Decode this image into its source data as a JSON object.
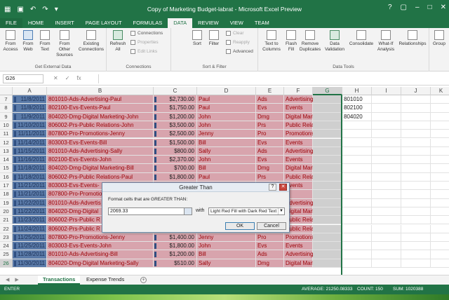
{
  "window": {
    "title": "Copy of Marketing Budget-labrat - Microsoft Excel Preview",
    "controls": [
      "?",
      "▢",
      "–",
      "□",
      "✕"
    ]
  },
  "ribbon_tabs": [
    "FILE",
    "HOME",
    "INSERT",
    "PAGE LAYOUT",
    "FORMULAS",
    "DATA",
    "REVIEW",
    "VIEW",
    "TEAM"
  ],
  "ribbon": {
    "get_external": {
      "label": "Get External Data",
      "buttons": [
        "From Access",
        "From Web",
        "From Text",
        "From Other Sources",
        "Existing Connections"
      ]
    },
    "connections": {
      "label": "Connections",
      "refresh": "Refresh All",
      "items": [
        "Connections",
        "Properties",
        "Edit Links"
      ]
    },
    "sort_filter": {
      "label": "Sort & Filter",
      "sort": "Sort",
      "filter": "Filter",
      "items": [
        "Clear",
        "Reapply",
        "Advanced"
      ]
    },
    "data_tools": {
      "label": "Data Tools",
      "buttons": [
        "Text to Columns",
        "Flash Fill",
        "Remove Duplicates",
        "Data Validation",
        "Consolidate",
        "What-If Analysis",
        "Relationships"
      ]
    },
    "outline": {
      "label": "Group"
    }
  },
  "formula_bar": {
    "name_box": "G26",
    "icons": [
      "✕",
      "✓",
      "fx"
    ],
    "value": ""
  },
  "columns": [
    "A",
    "B",
    "C",
    "D",
    "E",
    "F",
    "G",
    "H",
    "I",
    "J",
    "K"
  ],
  "rows": [
    {
      "n": "7",
      "a": "11/8/2011",
      "b": "801010-Ads-Advertising-Paul",
      "c": "$2,730.00",
      "d": "Paul",
      "e": "Ads",
      "f": "Advertising",
      "h": "801010"
    },
    {
      "n": "8",
      "a": "11/8/2011",
      "b": "802100-Evs-Events-Paul",
      "c": "$1,750.00",
      "d": "Paul",
      "e": "Evs",
      "f": "Events",
      "h": "802100"
    },
    {
      "n": "9",
      "a": "11/9/2011",
      "b": "804020-Dmg-Digital Marketing-John",
      "c": "$1,200.00",
      "d": "John",
      "e": "Dmg",
      "f": "Digital Marketing",
      "h": "804020"
    },
    {
      "n": "10",
      "a": "11/10/2011",
      "b": "806002-Prs-Public Relations-John",
      "c": "$3,500.00",
      "d": "John",
      "e": "Prs",
      "f": "Public Relations",
      "h": ""
    },
    {
      "n": "11",
      "a": "11/11/2011",
      "b": "807800-Pro-Promotions-Jenny",
      "c": "$2,500.00",
      "d": "Jenny",
      "e": "Pro",
      "f": "Promotions",
      "h": ""
    },
    {
      "n": "12",
      "a": "11/14/2011",
      "b": "803003-Evs-Events-Bill",
      "c": "$1,500.00",
      "d": "Bill",
      "e": "Evs",
      "f": "Events",
      "h": ""
    },
    {
      "n": "13",
      "a": "11/15/2011",
      "b": "801010-Ads-Advertising-Sally",
      "c": "$800.00",
      "d": "Sally",
      "e": "Ads",
      "f": "Advertising",
      "h": ""
    },
    {
      "n": "14",
      "a": "11/16/2011",
      "b": "802100-Evs-Events-John",
      "c": "$2,370.00",
      "d": "John",
      "e": "Evs",
      "f": "Events",
      "h": ""
    },
    {
      "n": "15",
      "a": "11/18/2011",
      "b": "804020-Dmg-Digital Marketing-Bill",
      "c": "$700.00",
      "d": "Bill",
      "e": "Dmg",
      "f": "Digital Marketing",
      "h": ""
    },
    {
      "n": "16",
      "a": "11/18/2011",
      "b": "806002-Prs-Public Relations-Paul",
      "c": "$1,800.00",
      "d": "Paul",
      "e": "Prs",
      "f": "Public Relations",
      "h": ""
    },
    {
      "n": "17",
      "a": "11/21/2011",
      "b": "803003-Evs-Events-",
      "c": "",
      "d": "",
      "e": "",
      "f": "Events",
      "h": ""
    },
    {
      "n": "18",
      "a": "11/21/2011",
      "b": "807800-Pro-Promotio",
      "c": "",
      "d": "",
      "e": "",
      "f": "",
      "h": ""
    },
    {
      "n": "19",
      "a": "11/22/2011",
      "b": "801010-Ads-Advertis",
      "c": "",
      "d": "",
      "e": "",
      "f": "Advertising",
      "h": ""
    },
    {
      "n": "20",
      "a": "11/22/2011",
      "b": "804020-Dmg-Digital",
      "c": "",
      "d": "",
      "e": "",
      "f": "Digital Marketing",
      "h": ""
    },
    {
      "n": "21",
      "a": "11/23/2011",
      "b": "806002-Prs-Public R",
      "c": "",
      "d": "",
      "e": "",
      "f": "Public Relations",
      "h": ""
    },
    {
      "n": "22",
      "a": "11/24/2011",
      "b": "806002-Prs-Public R",
      "c": "",
      "d": "",
      "e": "",
      "f": "Public Relations",
      "h": ""
    },
    {
      "n": "23",
      "a": "11/25/2011",
      "b": "807800-Pro-Promotions-Jenny",
      "c": "$1,400.00",
      "d": "Jenny",
      "e": "Pro",
      "f": "Promotions",
      "h": ""
    },
    {
      "n": "24",
      "a": "11/25/2011",
      "b": "803003-Evs-Events-John",
      "c": "$1,800.00",
      "d": "John",
      "e": "Evs",
      "f": "Events",
      "h": ""
    },
    {
      "n": "25",
      "a": "11/28/2011",
      "b": "801010-Ads-Advertising-Bill",
      "c": "$1,200.00",
      "d": "Bill",
      "e": "Ads",
      "f": "Advertising",
      "h": ""
    },
    {
      "n": "26",
      "a": "11/30/2011",
      "b": "804020-Dmg-Digital Marketing-Sally",
      "c": "$510.00",
      "d": "Sally",
      "e": "Dmg",
      "f": "Digital Marketing",
      "h": ""
    }
  ],
  "dialog": {
    "title": "Greater Than",
    "prompt": "Format cells that are GREATER THAN:",
    "value": "2069.33",
    "with_label": "with",
    "format": "Light Red Fill with Dark Red Text",
    "ok": "OK",
    "cancel": "Cancel"
  },
  "sheets": {
    "tabs": [
      "Transactions",
      "Expense Trends"
    ],
    "active": "Transactions",
    "add": "+"
  },
  "status": {
    "mode": "ENTER",
    "average": "AVERAGE: 21250.08333",
    "count": "COUNT: 150",
    "sum": "SUM: 1020388"
  },
  "colors": {
    "accent": "#217346",
    "highlight_fill": "#d8a4ad",
    "highlight_text": "#9c0006",
    "selected_fill": "#5a7aa8"
  }
}
